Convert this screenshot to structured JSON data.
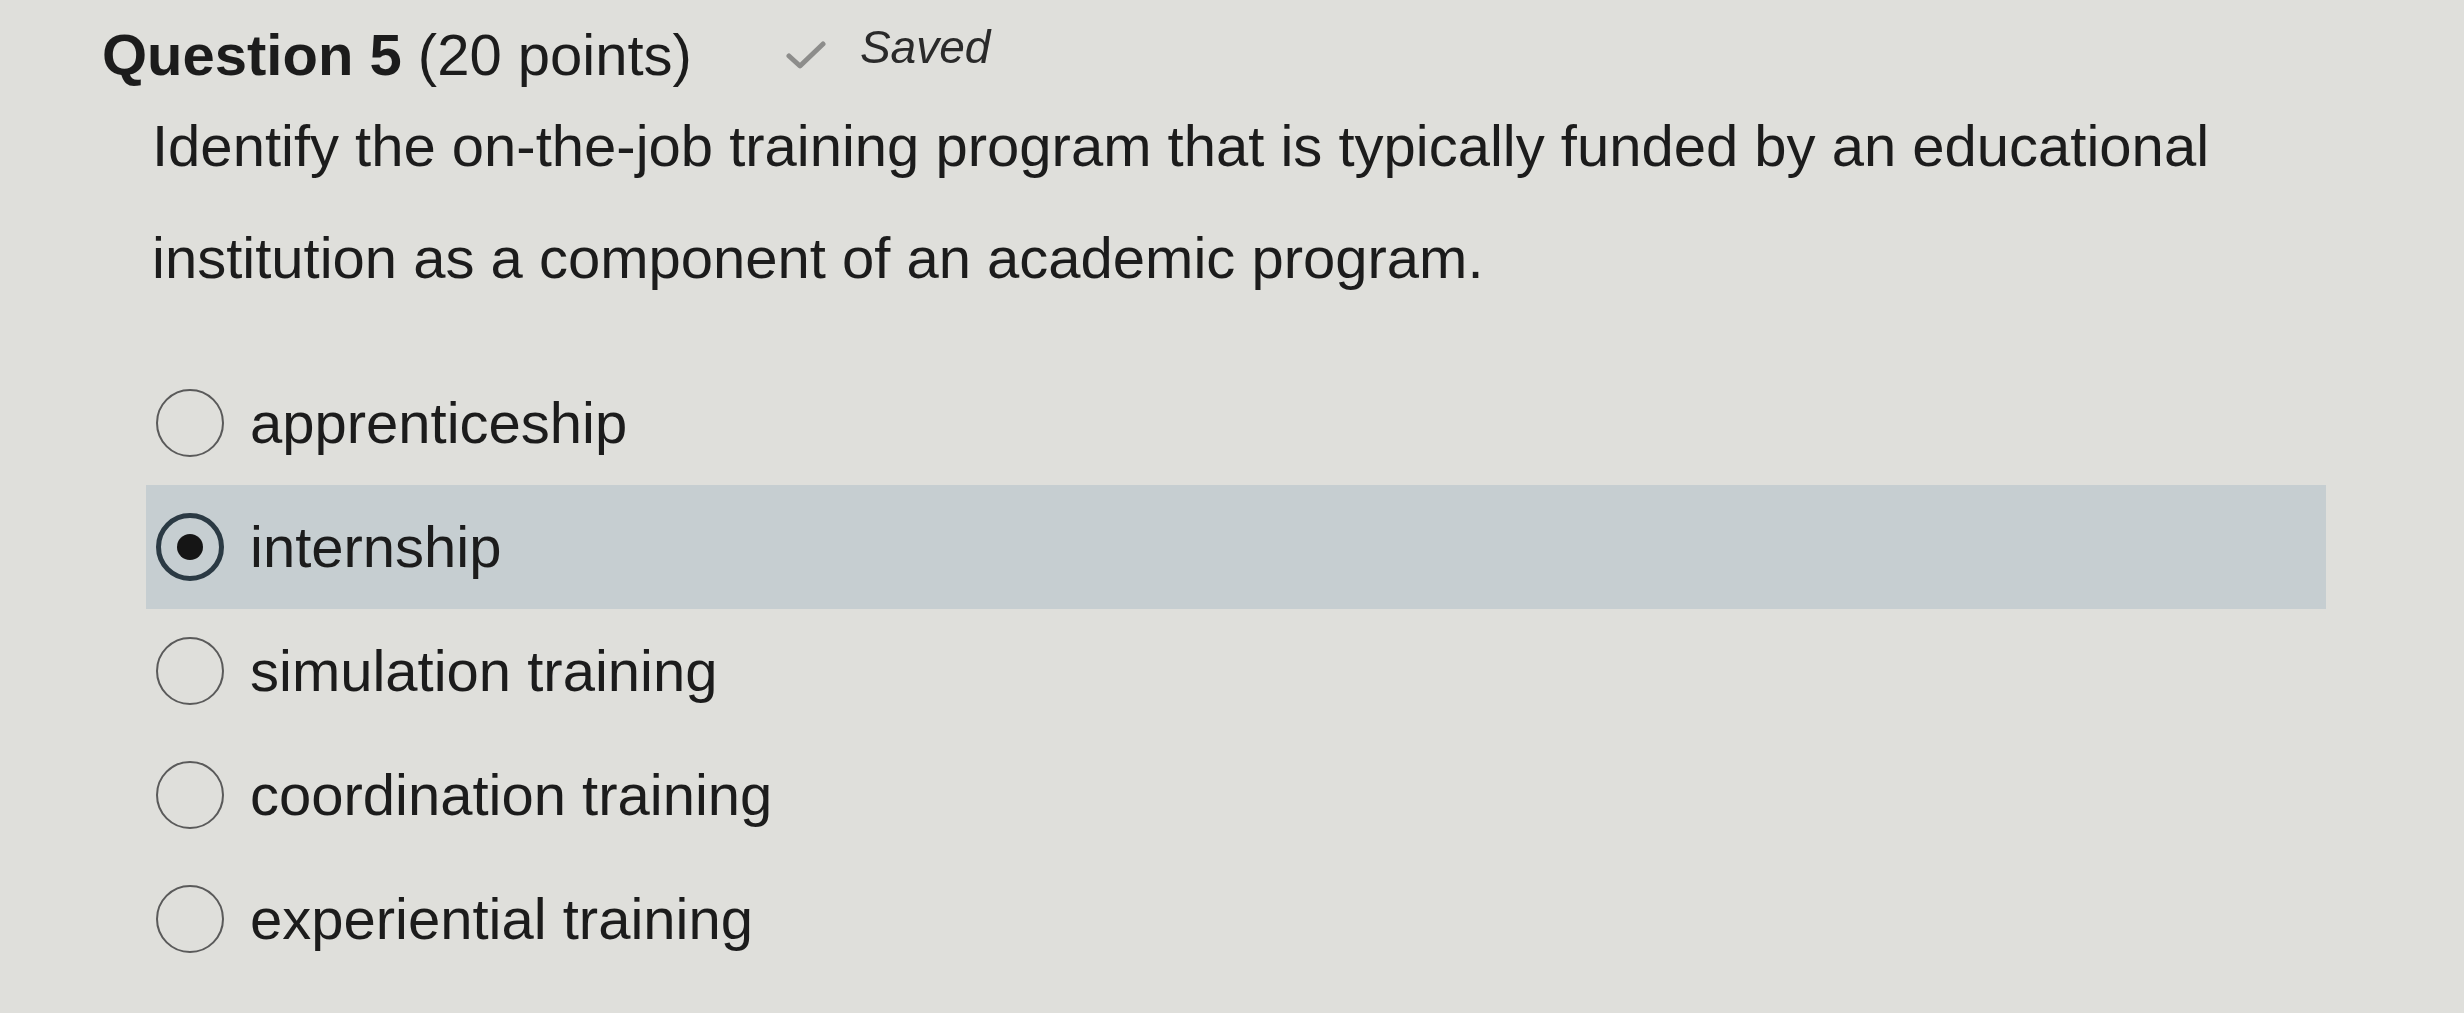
{
  "question": {
    "heading": "**Question 5** (20 points)",
    "status": "Saved",
    "prompt": "Identify the on-the-job training program that is typically funded by an educational institution as a component of an academic program."
  },
  "options": [
    {
      "label": "apprenticeship",
      "selected": false
    },
    {
      "label": "internship",
      "selected": true
    },
    {
      "label": "simulation training",
      "selected": false
    },
    {
      "label": "coordination training",
      "selected": false
    },
    {
      "label": "experiential training",
      "selected": false
    }
  ]
}
